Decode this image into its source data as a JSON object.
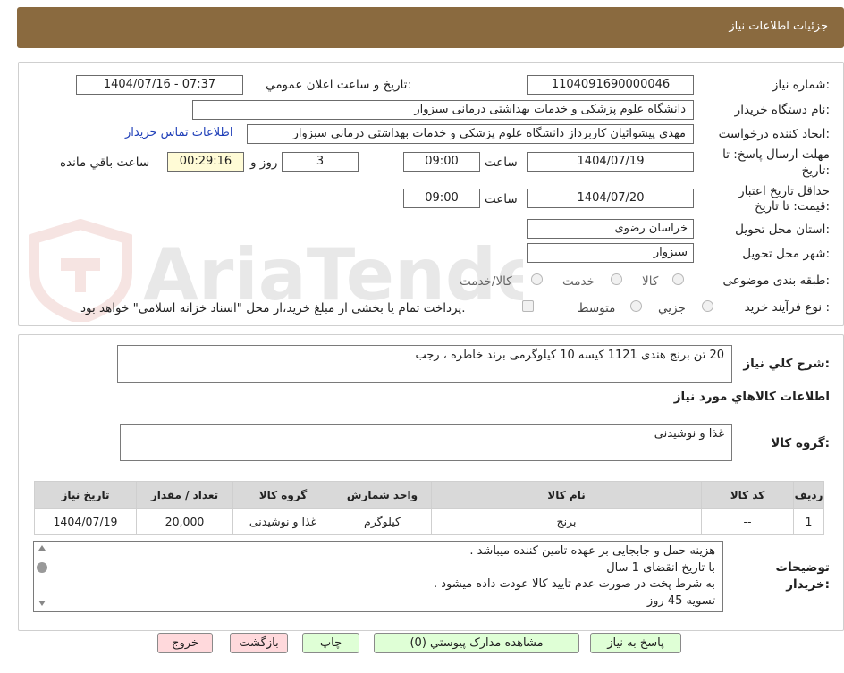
{
  "header": {
    "title": "جزئیات اطلاعات نیاز"
  },
  "form": {
    "need_number_label": "شماره نیاز:",
    "need_number": "1104091690000046",
    "announce_label": "تاریخ و ساعت اعلان عمومي:",
    "announce_value": "1404/07/16 - 07:37",
    "buyer_label": "نام دستگاه خریدار:",
    "buyer_value": "دانشگاه علوم پزشکی و خدمات بهداشتی  درمانی سبزوار",
    "requester_label": "ایجاد کننده درخواست:",
    "requester_value": "مهدی پیشوائیان کاربرداز دانشگاه علوم پزشکی و خدمات بهداشتی  درمانی سبزوار",
    "contact_link": "اطلاعات تماس خریدار",
    "deadline_label_1": "مهلت ارسال پاسخ: تا",
    "deadline_label_2": "تاریخ:",
    "deadline_date": "1404/07/19",
    "time_label": "ساعت",
    "deadline_time": "09:00",
    "days_value": "3",
    "days_label": "روز و",
    "remaining_time": "00:29:16",
    "remaining_label": "ساعت باقي مانده",
    "validity_label_1": "حداقل تاریخ اعتبار",
    "validity_label_2": "قیمت: تا تاریخ:",
    "validity_date": "1404/07/20",
    "validity_time": "09:00",
    "province_label": "استان محل تحویل:",
    "province_value": "خراسان رضوی",
    "city_label": "شهر محل تحویل:",
    "city_value": "سبزوار",
    "category_label": "طبقه بندی موضوعی:",
    "category_options": [
      "کالا",
      "خدمت",
      "کالا/خدمت"
    ],
    "process_label": "نوع فرآیند خرید :",
    "process_options": [
      "جزیي",
      "متوسط"
    ],
    "payment_note": "پرداخت تمام یا بخشی از مبلغ خرید،از محل \"اسناد خزانه اسلامی\" خواهد بود."
  },
  "watermark": {
    "text": "AriaTender.neT"
  },
  "details": {
    "summary_label": "شرح کلي نياز:",
    "summary_value": "20 تن برنج هندی 1121 کیسه 10 کیلوگرمی برند خاطره ، رجب",
    "goods_info_title": "اطلاعات کالاهاي مورد نياز",
    "goods_group_label": "گروه کالا:",
    "goods_group_value": "غذا و نوشیدنی",
    "table": {
      "headers": [
        "رديف",
        "کد کالا",
        "نام کالا",
        "واحد شمارش",
        "گروه کالا",
        "تعداد / مقدار",
        "تاريخ نياز"
      ],
      "rows": [
        [
          "1",
          "--",
          "برنج",
          "کیلوگرم",
          "غذا و نوشیدنی",
          "20,000",
          "1404/07/19"
        ]
      ]
    },
    "notes_label_1": "توضیحات",
    "notes_label_2": "خریدار:",
    "notes_lines": [
      "هزینه حمل و جابجایی بر عهده تامین کننده میباشد .",
      "با تاریخ انقضای 1 سال",
      "به شرط پخت در صورت عدم تایید کالا عودت داده میشود .",
      "تسویه 45 روز"
    ]
  },
  "buttons": {
    "reply": "پاسخ به نياز",
    "attachments": "مشاهده مدارک پیوستي (0)",
    "print": "چاپ",
    "back": "بازگشت",
    "exit": "خروج"
  }
}
